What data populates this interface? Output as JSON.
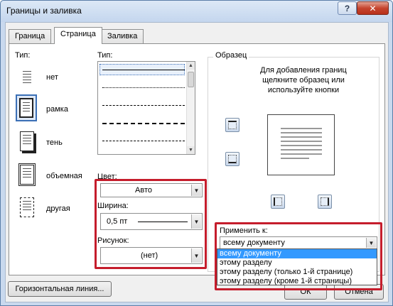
{
  "window": {
    "title": "Границы и заливка",
    "help_label": "?",
    "close_label": "✕"
  },
  "tabs": [
    {
      "label": "Граница"
    },
    {
      "label": "Страница"
    },
    {
      "label": "Заливка"
    }
  ],
  "setting": {
    "label": "Тип:",
    "items": [
      {
        "label": "нет"
      },
      {
        "label": "рамка"
      },
      {
        "label": "тень"
      },
      {
        "label": "объемная"
      },
      {
        "label": "другая"
      }
    ]
  },
  "style": {
    "label": "Тип:",
    "scroll_up": "▲",
    "scroll_down": "▼"
  },
  "color": {
    "label": "Цвет:",
    "value": "Авто"
  },
  "width": {
    "label": "Ширина:",
    "value": "0,5 пт"
  },
  "art": {
    "label": "Рисунок:",
    "value": "(нет)"
  },
  "preview": {
    "group_label": "Образец",
    "hint": [
      "Для добавления границ",
      "щелкните образец или",
      "используйте кнопки"
    ]
  },
  "apply_to": {
    "label": "Применить к:",
    "value": "всему документу",
    "options": [
      "всему документу",
      "этому разделу",
      "этому разделу (только 1-й странице)",
      "этому разделу (кроме 1-й страницы)"
    ],
    "selected_index": 0
  },
  "buttons": {
    "horizontal_line": "Горизонтальная линия...",
    "ok": "ОК",
    "cancel": "Отмена"
  },
  "colors": {
    "highlight_border": "#c51d2c",
    "selection": "#3399ff"
  },
  "icons": {
    "dropdown": "▼",
    "help": "question-icon",
    "close": "close-icon"
  }
}
